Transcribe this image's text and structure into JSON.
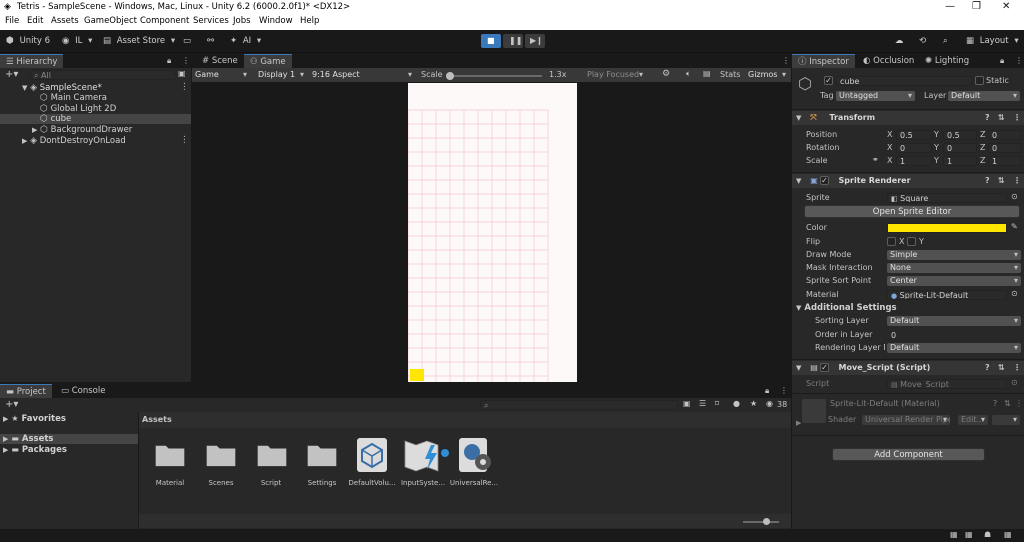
{
  "window": {
    "title": "Tetris - SampleScene - Windows, Mac, Linux - Unity 6.2 (6000.2.0f1)* <DX12>",
    "controls": [
      "—",
      "❐",
      "✕"
    ]
  },
  "menu": [
    "File",
    "Edit",
    "Assets",
    "GameObject",
    "Component",
    "Services",
    "Jobs",
    "Window",
    "Help"
  ],
  "toolbar": {
    "unity": "Unity 6",
    "account": "IL",
    "asset_store": "Asset Store",
    "ai": "AI",
    "layout": "Layout"
  },
  "hierarchy": {
    "tab": "Hierarchy",
    "search_placeholder": "All",
    "scene": "SampleScene*",
    "items": [
      "Main Camera",
      "Global Light 2D",
      "cube",
      "BackgroundDrawer"
    ],
    "dont_destroy": "DontDestroyOnLoad"
  },
  "center_tabs": [
    "Scene",
    "Game"
  ],
  "game_bar": {
    "mode": "Game",
    "display": "Display 1",
    "aspect": "9:16 Aspect",
    "scale_label": "Scale",
    "scale_value": "1.3x",
    "play_focused": "Play Focused",
    "stats": "Stats",
    "gizmos": "Gizmos"
  },
  "colors": {
    "accent": "#3a79bb",
    "sprite_color": "#ffe600",
    "grid_line": "#f3c6cf",
    "game_bg": "#fdf9f8"
  },
  "inspector": {
    "tabs": [
      "Inspector",
      "Occlusion",
      "Lighting"
    ],
    "object_name": "cube",
    "static": "Static",
    "tag_label": "Tag",
    "tag": "Untagged",
    "layer_label": "Layer",
    "layer": "Default",
    "transform": {
      "header": "Transform",
      "position_label": "Position",
      "position": [
        "0.5",
        "0.5",
        "0"
      ],
      "rotation_label": "Rotation",
      "rotation": [
        "0",
        "0",
        "0"
      ],
      "scale_label": "Scale",
      "scale": [
        "1",
        "1",
        "1"
      ]
    },
    "sprite_renderer": {
      "header": "Sprite Renderer",
      "sprite_label": "Sprite",
      "sprite": "Square",
      "open_editor": "Open Sprite Editor",
      "color_label": "Color",
      "flip_label": "Flip",
      "flip_x": "X",
      "flip_y": "Y",
      "draw_mode_label": "Draw Mode",
      "draw_mode": "Simple",
      "mask_label": "Mask Interaction",
      "mask": "None",
      "sort_point_label": "Sprite Sort Point",
      "sort_point": "Center",
      "material_label": "Material",
      "material": "Sprite-Lit-Default",
      "additional": "Additional Settings",
      "sorting_layer_label": "Sorting Layer",
      "sorting_layer": "Default",
      "order_label": "Order in Layer",
      "order": "0",
      "rendering_layer_label": "Rendering Layer M",
      "rendering_layer": "Default"
    },
    "move_script": {
      "header": "Move_Script (Script)",
      "script_label": "Script",
      "script": "Move_Script"
    },
    "material_block": {
      "name": "Sprite-Lit-Default (Material)",
      "shader_label": "Shader",
      "shader": "Universal Render Pipe",
      "edit": "Edit..."
    },
    "add_component": "Add Component"
  },
  "project": {
    "tabs": [
      "Project",
      "Console"
    ],
    "favorites": "Favorites",
    "assets": "Assets",
    "packages": "Packages",
    "breadcrumb": "Assets",
    "hidden_count": "38",
    "items": [
      "Material",
      "Scenes",
      "Script",
      "Settings",
      "DefaultVolu...",
      "InputSyste...",
      "UniversalRe..."
    ]
  }
}
